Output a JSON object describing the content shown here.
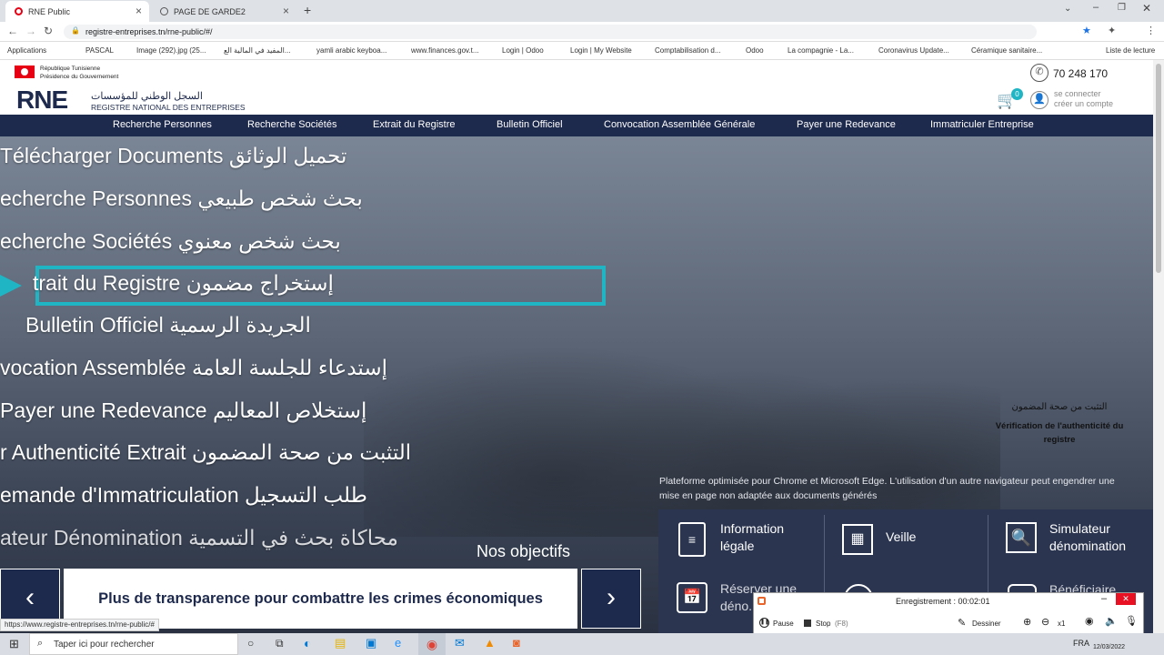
{
  "browser": {
    "tabs": [
      {
        "label": "RNE Public",
        "active": true
      },
      {
        "label": "PAGE DE GARDE2",
        "active": false
      }
    ],
    "url": "registre-entreprises.tn/rne-public/#/",
    "bookmarks": [
      "Applications",
      "PASCAL",
      "Image (292).jpg (25...",
      "المفيد في المالية الع...",
      "yamli arabic keyboa...",
      "www.finances.gov.t...",
      "Login | Odoo",
      "Login | My Website",
      "Comptabilisation d...",
      "Odoo",
      "La compagnie - La...",
      "Coronavirus Update...",
      "Céramique sanitaire...",
      "Liste de lecture"
    ],
    "status_url": "https://www.registre-entreprises.tn/rne-public/#"
  },
  "header": {
    "gov_line1": "République Tunisienne",
    "gov_line2": "Présidence du Gouvernement",
    "logo": "RNE",
    "logo_ar": "السجل الوطني للمؤسسات",
    "logo_fr": "REGISTRE NATIONAL DES ENTREPRISES",
    "phone": "70 248 170",
    "cart_count": "0",
    "login": "se connecter",
    "signup": "créer un compte"
  },
  "nav": [
    "Recherche Personnes",
    "Recherche Sociétés",
    "Extrait du Registre",
    "Bulletin Officiel",
    "Convocation Assemblée Générale",
    "Payer une Redevance",
    "Immatriculer Entreprise"
  ],
  "menu": [
    "Télécharger Documents تحميل الوثائق",
    "echerche Personnes بحث شخص طبيعي",
    "echerche Sociétés بحث شخص معنوي",
    "trait du Registre إستخراج مضمون",
    "Bulletin Officiel الجريدة الرسمية",
    "vocation Assemblée إستدعاء للجلسة العامة",
    "Payer une Redevance إستخلاص المعاليم",
    "r Authenticité Extrait التثبت من صحة المضمون",
    "emande d'Immatriculation طلب التسجيل",
    "ateur Dénomination محاكاة بحث في التسمية"
  ],
  "verify": {
    "ar": "التثبت من صحة المضمون",
    "fr": "Vérification de l'authenticité du registre"
  },
  "notice": "Plateforme optimisée pour Chrome et Microsoft Edge. L'utilisation d'un autre navigateur peut engendrer une mise en page non adaptée aux documents générés",
  "objectifs": {
    "title": "Nos objectifs",
    "text": "Plus de transparence pour combattre les crimes économiques"
  },
  "services": [
    "Information légale",
    "Veille",
    "Simulateur dénomination",
    "Réserver une déno...",
    "Bénéficiaire"
  ],
  "recorder": {
    "title": "Enregistrement : 00:02:01",
    "pause": "Pause",
    "stop": "Stop",
    "stop_key": "(F8)",
    "draw": "Dessiner",
    "zoom": "x1"
  },
  "taskbar": {
    "search": "Taper ici pour rechercher",
    "lang": "FRA",
    "date": "12/03/2022"
  },
  "colors": {
    "nav": "#1e2a4d",
    "accent": "#1fb5c4",
    "flag": "#e70013"
  }
}
